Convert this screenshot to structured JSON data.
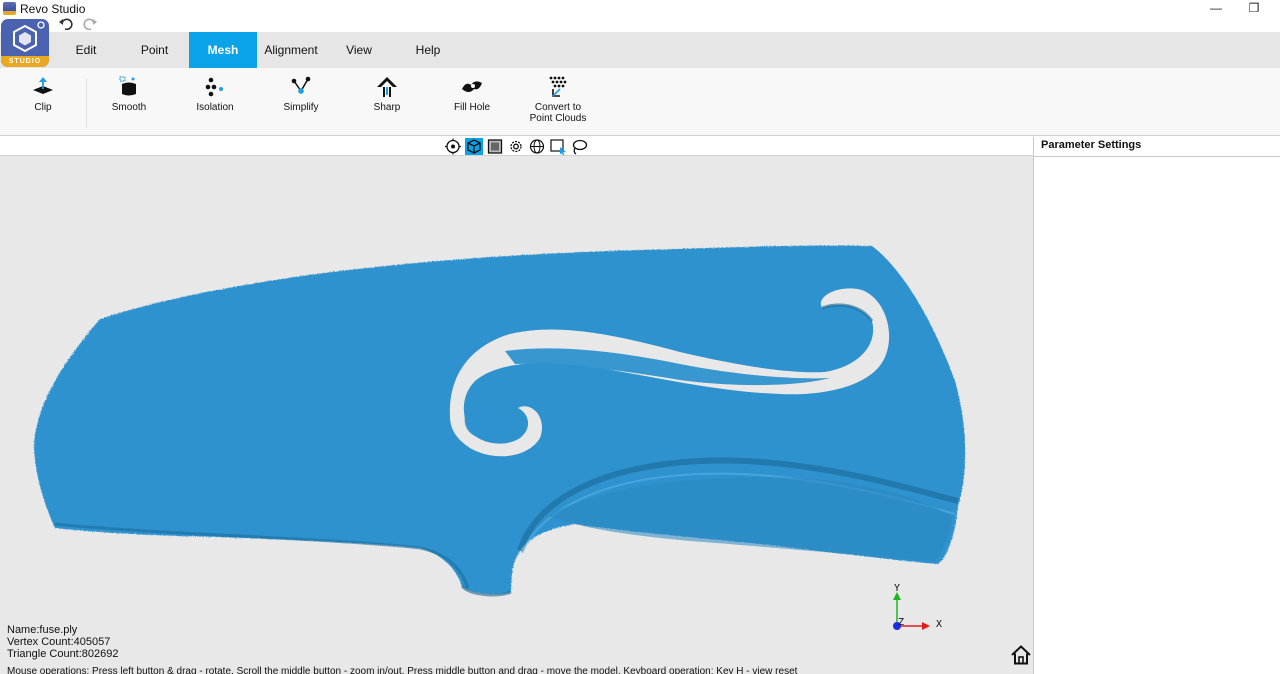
{
  "window": {
    "title": "Revo Studio",
    "minimize_glyph": "—",
    "maximize_glyph": "❐"
  },
  "quick_access": {
    "undo_icon": "undo-icon",
    "redo_icon": "redo-icon"
  },
  "logo": {
    "badge": "STUDIO"
  },
  "menu": {
    "tabs": [
      {
        "label": "Edit"
      },
      {
        "label": "Point"
      },
      {
        "label": "Mesh",
        "active": true
      },
      {
        "label": "Alignment"
      },
      {
        "label": "View"
      },
      {
        "label": "Help"
      }
    ]
  },
  "ribbon": {
    "tools": [
      {
        "label": "Clip",
        "icon": "clip-icon"
      },
      {
        "label": "Smooth",
        "icon": "smooth-icon"
      },
      {
        "label": "Isolation",
        "icon": "isolation-icon"
      },
      {
        "label": "Simplify",
        "icon": "simplify-icon"
      },
      {
        "label": "Sharp",
        "icon": "sharp-icon"
      },
      {
        "label": "Fill Hole",
        "icon": "fill-hole-icon"
      },
      {
        "label": "Convert to",
        "label2": "Point Clouds",
        "icon": "convert-icon"
      }
    ]
  },
  "view_toolbar": {
    "buttons": [
      "target-icon",
      "cube-icon",
      "shaded-icon",
      "gear-view-icon",
      "globe-icon",
      "select-rect-icon",
      "lasso-icon"
    ],
    "active_index": 1
  },
  "viewport": {
    "mesh_color": "#2f92cf",
    "info": {
      "name": "Name:fuse.ply",
      "vertex": "Vertex Count:405057",
      "triangle": "Triangle Count:802692"
    },
    "mouse_hint": "Mouse operations: Press left button & drag - rotate, Scroll the middle button - zoom in/out, Press middle button and drag - move the model. Keyboard operation: Key H - view reset",
    "axis": {
      "x": "X",
      "y": "Y",
      "z": "Z"
    }
  },
  "panel": {
    "title": "Parameter Settings"
  },
  "colors": {
    "accent": "#0aa3e8",
    "menubar": "#e6e6e6",
    "viewport": "#e8e8e8"
  }
}
